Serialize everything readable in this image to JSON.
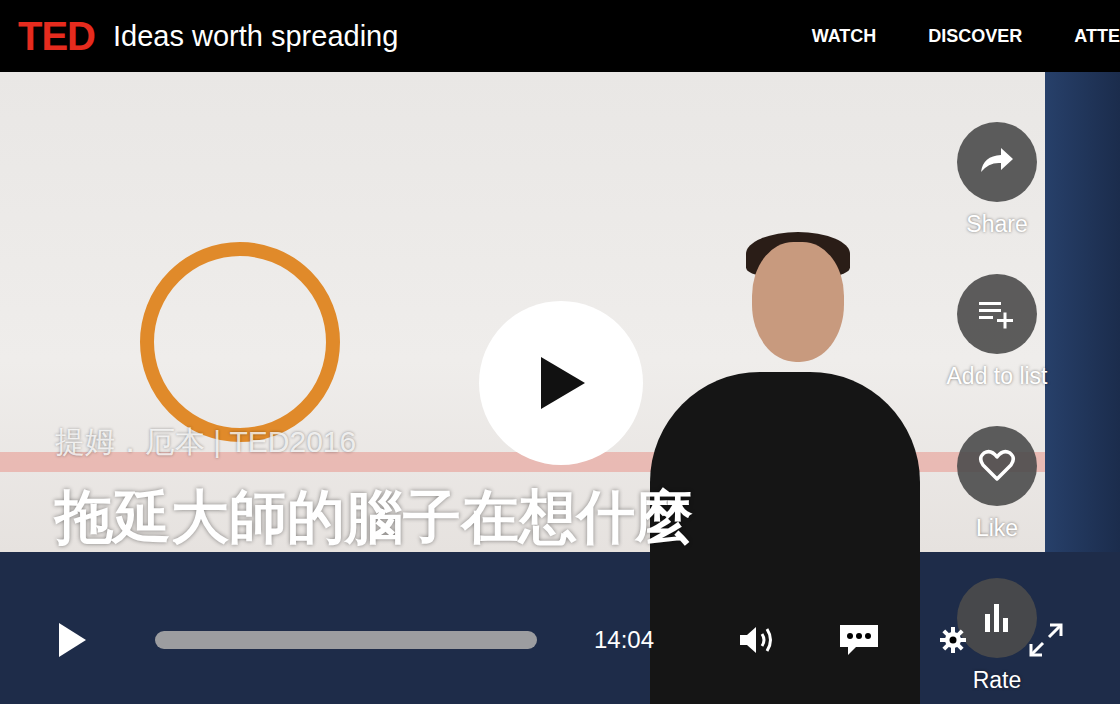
{
  "header": {
    "logo": "TED",
    "tagline": "Ideas worth spreading",
    "nav": [
      {
        "label": "WATCH"
      },
      {
        "label": "DISCOVER"
      },
      {
        "label": "ATTE"
      }
    ]
  },
  "video": {
    "speaker_event": "提姆．厄本 | TED2016",
    "title": "拖延大師的腦子在想什麼",
    "actions": [
      {
        "label": "Share"
      },
      {
        "label": "Add to list"
      },
      {
        "label": "Like"
      },
      {
        "label": "Rate"
      }
    ],
    "controls": {
      "duration": "14:04",
      "progress": {
        "level": 0
      }
    }
  }
}
